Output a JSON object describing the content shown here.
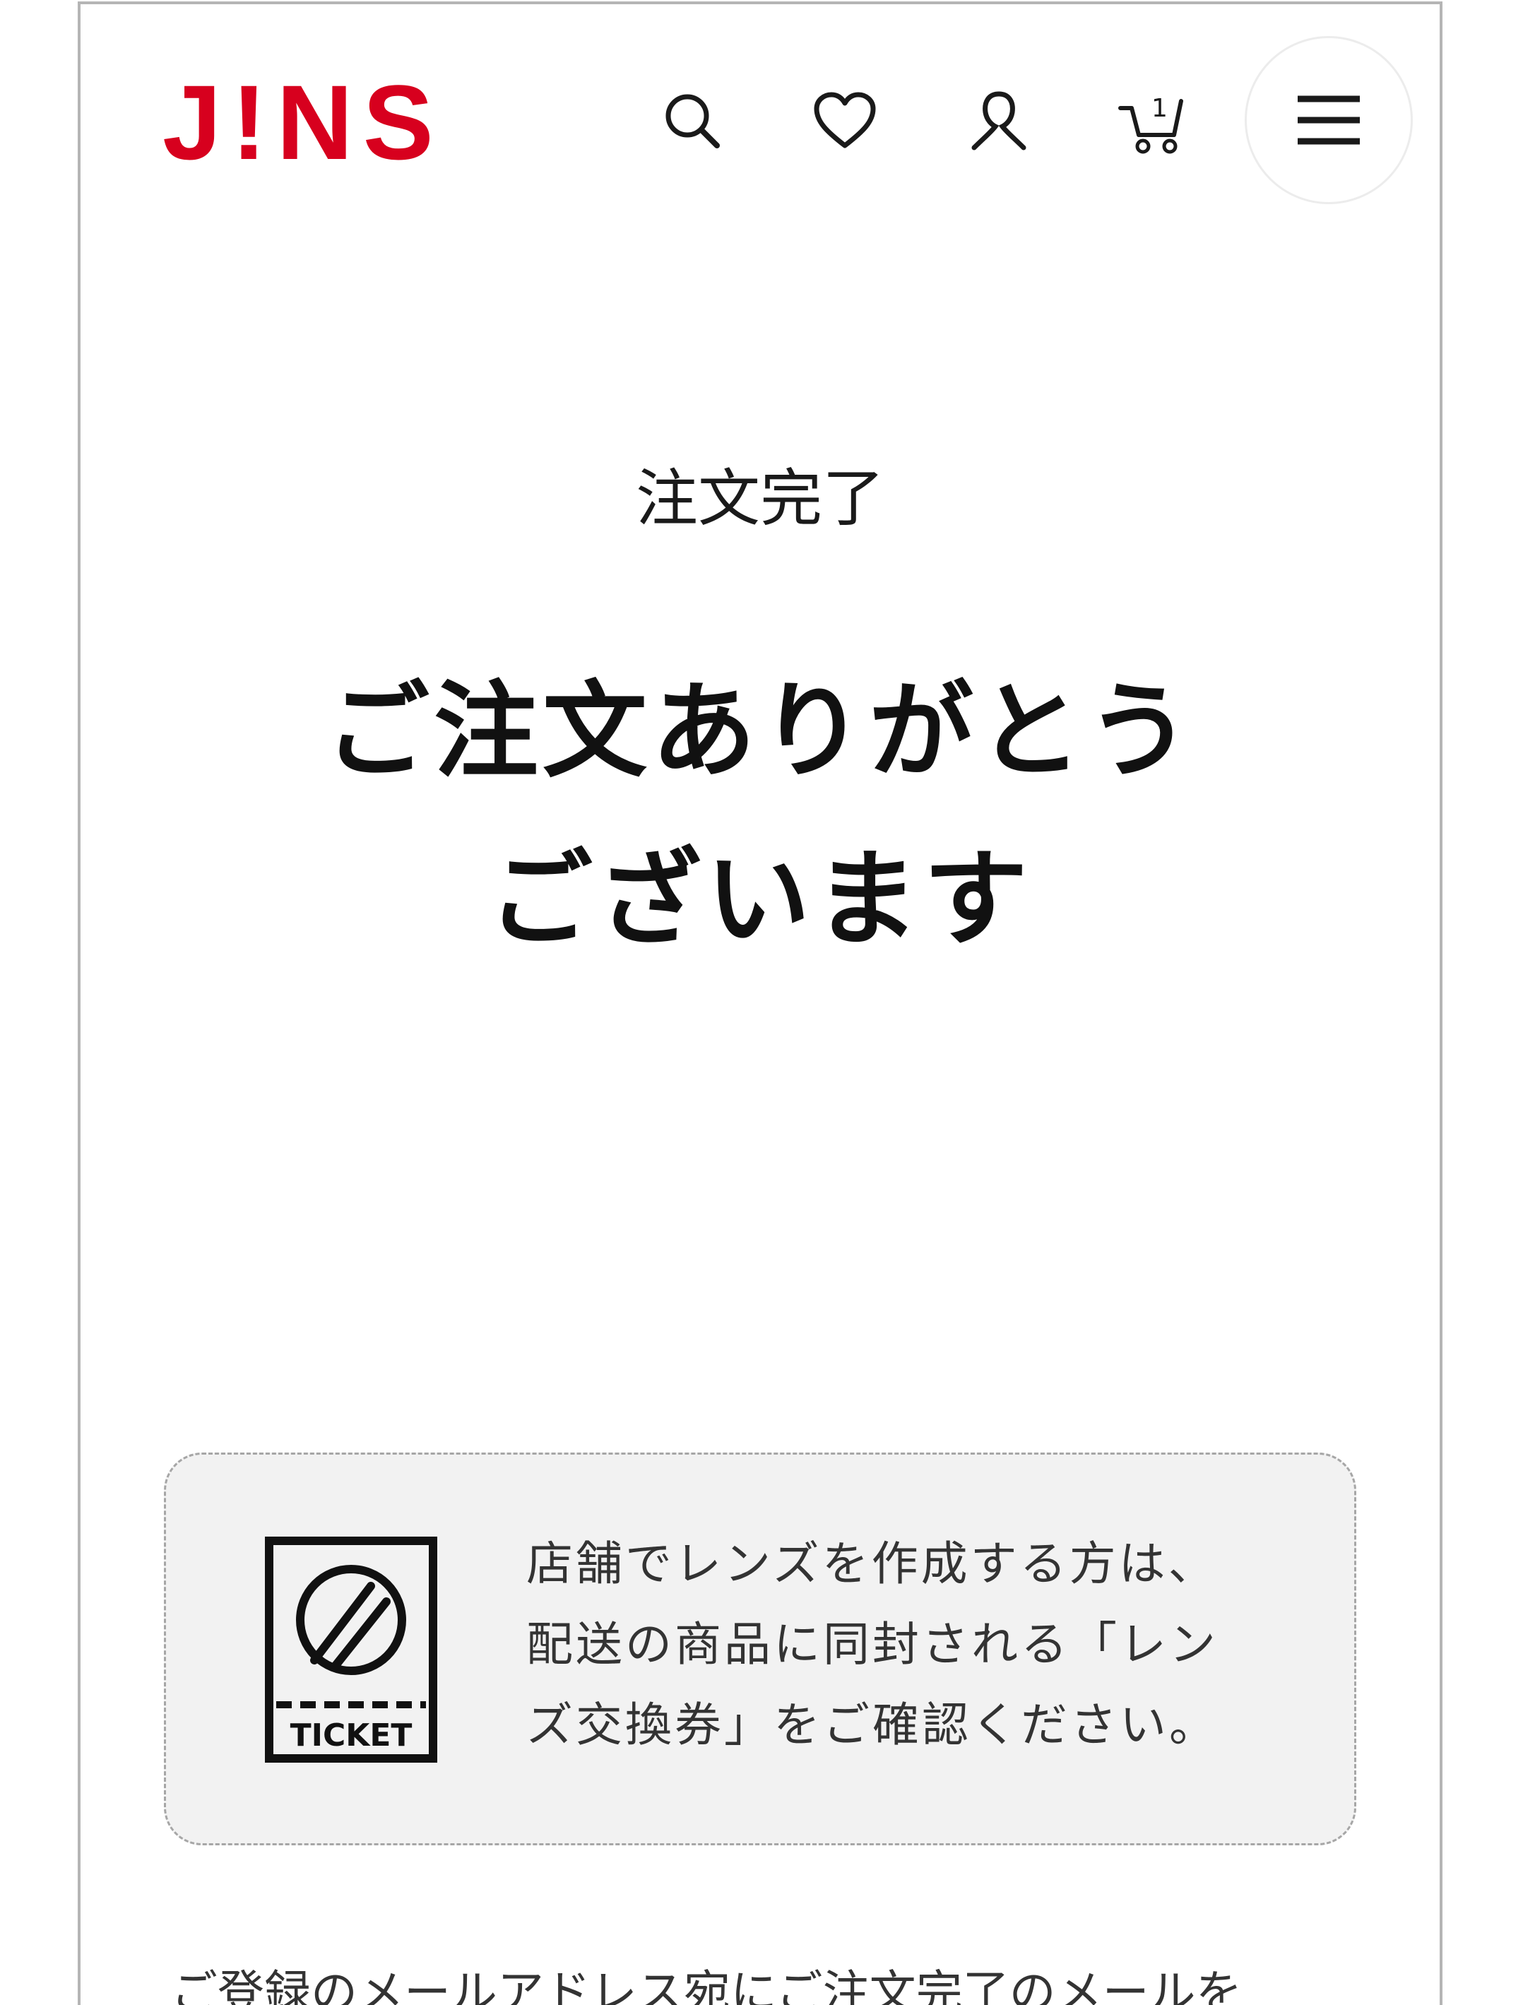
{
  "header": {
    "logo": "J!NS",
    "colors": {
      "brand": "#d7001e",
      "icon": "#1a1a1a"
    },
    "icons": [
      "search-icon",
      "heart-icon",
      "user-icon",
      "cart-icon",
      "menu-icon"
    ],
    "cart_count": "1"
  },
  "page": {
    "subtitle": "注文完了",
    "title_line1": "ご注文ありがとう",
    "title_line2": "ございます"
  },
  "notice": {
    "icon_label": "TICKET",
    "line1": "店舗でレンズを作成する方は、",
    "line2": "配送の商品に同封される「レン",
    "line3": "ズ交換券」をご確認ください。"
  },
  "footer_text": "ご登録のメールアドレス宛にご注文完了のメールを"
}
